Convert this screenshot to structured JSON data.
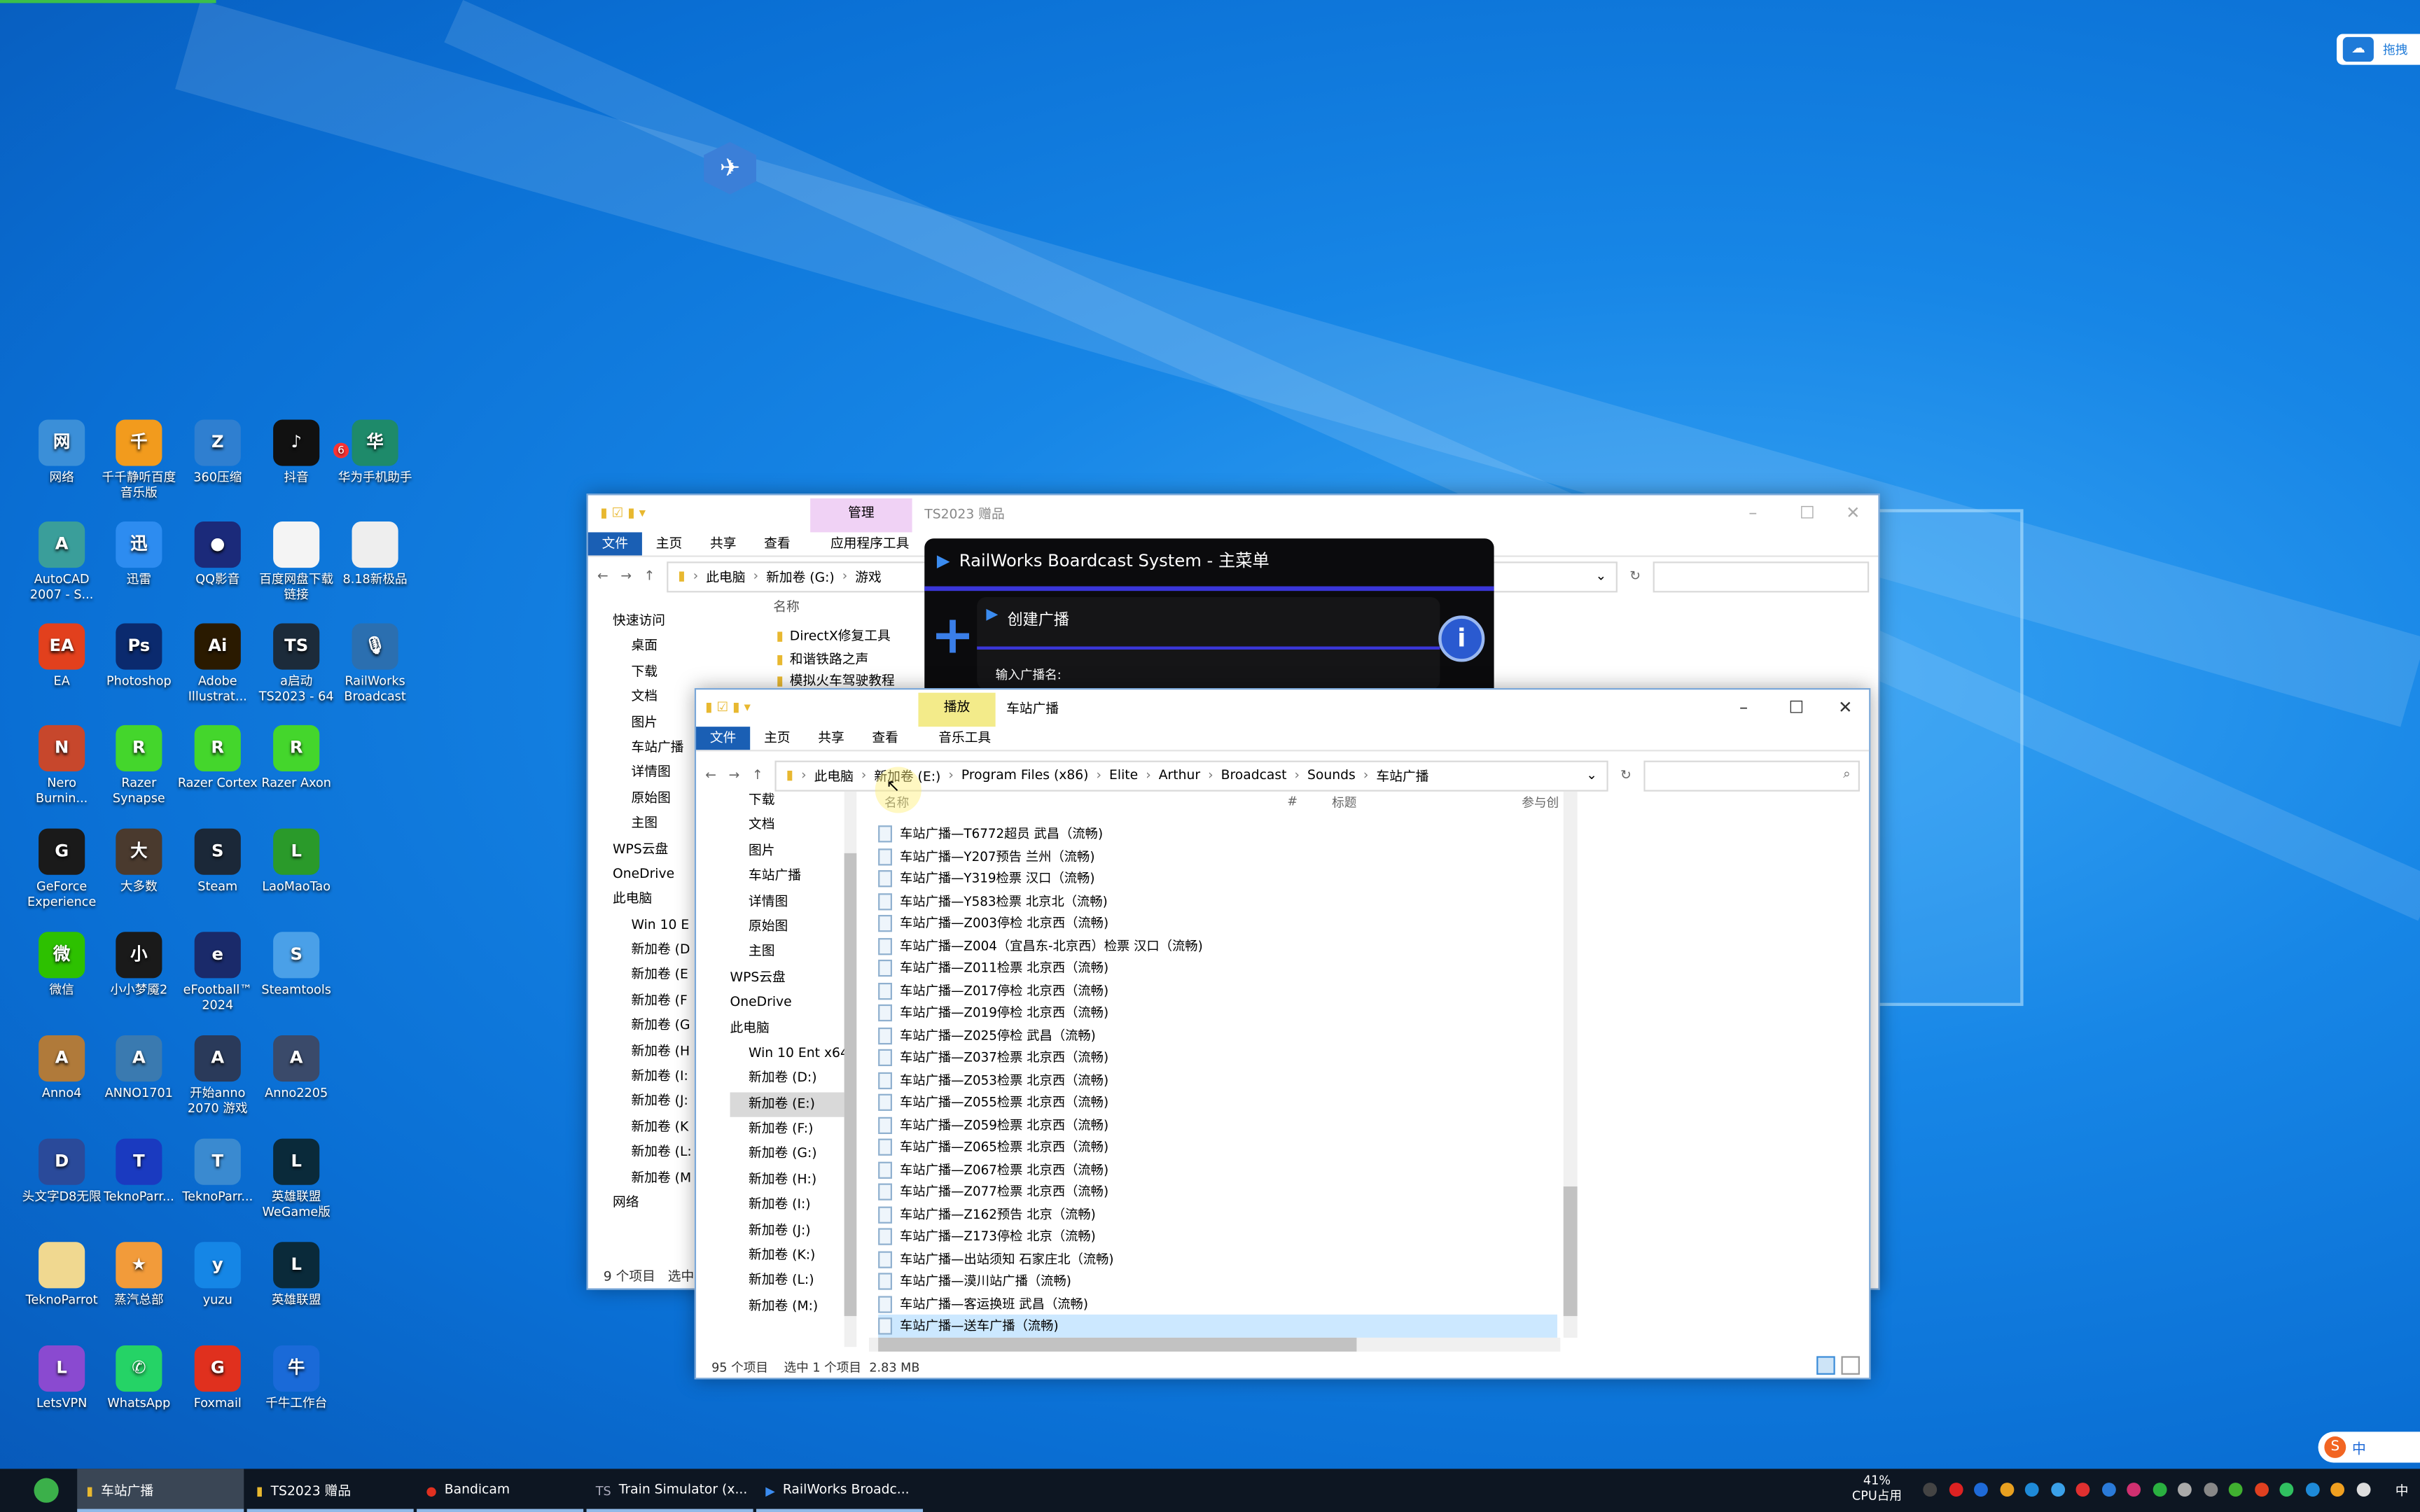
{
  "desktop": {
    "icons": [
      {
        "label": "网络",
        "color": "#3b8fd8",
        "glyph": "网"
      },
      {
        "label": "千千静听百度音乐版",
        "color": "#f29b1d",
        "glyph": "千"
      },
      {
        "label": "360压缩",
        "color": "#2f7fd0",
        "glyph": "Z"
      },
      {
        "label": "抖音",
        "color": "#111111",
        "glyph": "♪",
        "badge": "6"
      },
      {
        "label": "华为手机助手",
        "color": "#1e8a6a",
        "glyph": "华"
      },
      {
        "label": "AutoCAD 2007 - S...",
        "color": "#3a9e9a",
        "glyph": "A"
      },
      {
        "label": "迅雷",
        "color": "#2d8cf0",
        "glyph": "迅"
      },
      {
        "label": "QQ影音",
        "color": "#1b2a7a",
        "glyph": "●"
      },
      {
        "label": "百度网盘下载链接",
        "color": "#f4f4f4",
        "glyph": ""
      },
      {
        "label": "8.18新极品",
        "color": "#eeeeee",
        "glyph": ""
      },
      {
        "label": "EA",
        "color": "#e2401d",
        "glyph": "EA"
      },
      {
        "label": "Photoshop",
        "color": "#0b2a6e",
        "glyph": "Ps"
      },
      {
        "label": "Adobe Illustrat...",
        "color": "#2a1a00",
        "glyph": "Ai"
      },
      {
        "label": "a启动 TS2023 - 64",
        "color": "#1c2b3a",
        "glyph": "TS"
      },
      {
        "label": "RailWorks Broadcast",
        "color": "#2b6fb0",
        "glyph": "🎙"
      },
      {
        "label": "Nero Burnin...",
        "color": "#c7472c",
        "glyph": "N"
      },
      {
        "label": "Razer Synapse",
        "color": "#44d62c",
        "glyph": "R"
      },
      {
        "label": "Razer Cortex",
        "color": "#44d62c",
        "glyph": "R"
      },
      {
        "label": "Razer Axon",
        "color": "#44d62c",
        "glyph": "R"
      },
      {
        "label": "GeForce Experience",
        "color": "#1a1a1a",
        "glyph": "G"
      },
      {
        "label": "大多数",
        "color": "#4a3a2e",
        "glyph": "大"
      },
      {
        "label": "Steam",
        "color": "#1b2838",
        "glyph": "S"
      },
      {
        "label": "LaoMaoTao",
        "color": "#2a9a2a",
        "glyph": "L"
      },
      {
        "label": "微信",
        "color": "#2dc100",
        "glyph": "微"
      },
      {
        "label": "小小梦魇2",
        "color": "#1a1a1a",
        "glyph": "小"
      },
      {
        "label": "eFootball™ 2024",
        "color": "#1a2a6a",
        "glyph": "e"
      },
      {
        "label": "Steamtools",
        "color": "#4aa0e8",
        "glyph": "S"
      },
      {
        "label": "Anno4",
        "color": "#b07a3a",
        "glyph": "A"
      },
      {
        "label": "ANNO1701",
        "color": "#3a7ab0",
        "glyph": "A"
      },
      {
        "label": "开始anno 2070 游戏",
        "color": "#2a3a5a",
        "glyph": "A"
      },
      {
        "label": "Anno2205",
        "color": "#3a4a6a",
        "glyph": "A"
      },
      {
        "label": "头文字D8无限",
        "color": "#2a4a9a",
        "glyph": "D"
      },
      {
        "label": "TeknoParr...",
        "color": "#1a3ac0",
        "glyph": "T"
      },
      {
        "label": "TeknoParr...",
        "color": "#3a8ad0",
        "glyph": "T"
      },
      {
        "label": "英雄联盟 WeGame版",
        "color": "#0a2a3a",
        "glyph": "L"
      },
      {
        "label": "TeknoParrot",
        "color": "#f0d890",
        "glyph": ""
      },
      {
        "label": "蒸汽总部",
        "color": "#f29b3a",
        "glyph": "★"
      },
      {
        "label": "yuzu",
        "color": "#1586e6",
        "glyph": "y"
      },
      {
        "label": "英雄联盟",
        "color": "#0a2a3a",
        "glyph": "L"
      },
      {
        "label": "LetsVPN",
        "color": "#8a4ad0",
        "glyph": "L"
      },
      {
        "label": "WhatsApp",
        "color": "#25d366",
        "glyph": "✆"
      },
      {
        "label": "Foxmail",
        "color": "#e0301e",
        "glyph": "G"
      },
      {
        "label": "千牛工作台",
        "color": "#1a6ad8",
        "glyph": "牛"
      }
    ],
    "top_right_widget": "拖拽"
  },
  "back_window": {
    "title": "TS2023 赠品",
    "context_tab": "管理",
    "tabs": [
      "文件",
      "主页",
      "共享",
      "查看",
      "应用程序工具"
    ],
    "breadcrumb": [
      "此电脑",
      "新加卷 (G:)",
      "游戏"
    ],
    "column_name": "名称",
    "nav": [
      "快速访问",
      "桌面",
      "下载",
      "文档",
      "图片",
      "车站广播",
      "详情图",
      "原始图",
      "主图",
      "WPS云盘",
      "OneDrive",
      "此电脑",
      "Win 10 E",
      "新加卷 (D",
      "新加卷 (E",
      "新加卷 (F",
      "新加卷 (G",
      "新加卷 (H",
      "新加卷 (I:",
      "新加卷 (J:",
      "新加卷 (K",
      "新加卷 (L:",
      "新加卷 (M",
      "网络"
    ],
    "files": [
      "DirectX修复工具",
      "和谐铁路之声",
      "模拟火车驾驶教程"
    ],
    "status": [
      "9 个项目",
      "选中"
    ]
  },
  "dialog": {
    "title": "RailWorks Boardcast System - 主菜单",
    "create_label": "创建广播",
    "input_label": "输入广播名:"
  },
  "front_window": {
    "title": "车站广播",
    "context_tab": "播放",
    "tabs": [
      "文件",
      "主页",
      "共享",
      "查看",
      "音乐工具"
    ],
    "breadcrumb": [
      "此电脑",
      "新加卷 (E:)",
      "Program Files (x86)",
      "Elite",
      "Arthur",
      "Broadcast",
      "Sounds",
      "车站广播"
    ],
    "columns": [
      "名称",
      "#",
      "标题",
      "参与创"
    ],
    "nav": [
      "下载",
      "文档",
      "图片",
      "车站广播",
      "详情图",
      "原始图",
      "主图",
      "WPS云盘",
      "OneDrive",
      "此电脑",
      "Win 10 Ent x64",
      "新加卷 (D:)",
      "新加卷 (E:)",
      "新加卷 (F:)",
      "新加卷 (G:)",
      "新加卷 (H:)",
      "新加卷 (I:)",
      "新加卷 (J:)",
      "新加卷 (K:)",
      "新加卷 (L:)",
      "新加卷 (M:)"
    ],
    "selected_nav": "新加卷 (E:)",
    "files": [
      "车站广播—T6772超员 武昌（流畅)",
      "车站广播—Y207预告 兰州（流畅)",
      "车站广播—Y319检票 汉口（流畅)",
      "车站广播—Y583检票 北京北（流畅)",
      "车站广播—Z003停检 北京西（流畅)",
      "车站广播—Z004（宜昌东-北京西）检票 汉口（流畅)",
      "车站广播—Z011检票 北京西（流畅)",
      "车站广播—Z017停检 北京西（流畅)",
      "车站广播—Z019停检 北京西（流畅)",
      "车站广播—Z025停检 武昌（流畅)",
      "车站广播—Z037检票 北京西（流畅)",
      "车站广播—Z053检票 北京西（流畅)",
      "车站广播—Z055检票 北京西（流畅)",
      "车站广播—Z059检票 北京西（流畅)",
      "车站广播—Z065检票 北京西（流畅)",
      "车站广播—Z067检票 北京西（流畅)",
      "车站广播—Z077检票 北京西（流畅)",
      "车站广播—Z162预告 北京（流畅)",
      "车站广播—Z173停检 北京（流畅)",
      "车站广播—出站须知 石家庄北（流畅)",
      "车站广播—漠川站广播（流畅)",
      "车站广播—客运换班 武昌（流畅)",
      "车站广播—送车广播（流畅)"
    ],
    "selected_file": "车站广播—送车广播（流畅)",
    "status": {
      "count": "95 个项目",
      "selection": "选中 1 个项目",
      "size": "2.83 MB"
    }
  },
  "taskbar": {
    "items": [
      {
        "label": "车站广播",
        "active": true,
        "icon": "folder-icon"
      },
      {
        "label": "TS2023 赠品",
        "icon": "folder-icon"
      },
      {
        "label": "Bandicam",
        "icon": "record-icon"
      },
      {
        "label": "Train Simulator (x...",
        "icon": "ts-icon"
      },
      {
        "label": "RailWorks Broadc...",
        "icon": "play-icon"
      }
    ],
    "cpu_percent": "41%",
    "cpu_label": "CPU占用",
    "ime": "中",
    "tray_colors": [
      "#444",
      "#d22",
      "#1e6ad8",
      "#e8a020",
      "#1e8ad8",
      "#3aa0e8",
      "#e03030",
      "#2a7ad8",
      "#d03070",
      "#2ab040",
      "#aaa",
      "#888",
      "#40b030",
      "#e04020",
      "#30c060",
      "#1e8ad8",
      "#f0a020",
      "#ddd"
    ]
  }
}
